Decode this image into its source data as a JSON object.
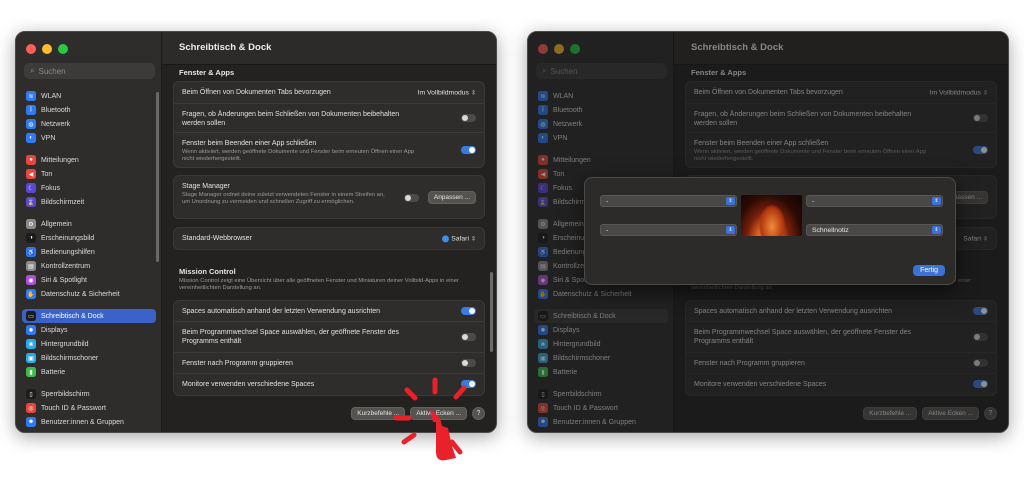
{
  "window": {
    "title": "Schreibtisch & Dock",
    "search_placeholder": "Suchen",
    "sidebar": [
      {
        "label": "WLAN",
        "icon": "wifi-icon",
        "color": "#2f7bf6",
        "glyph": "≋"
      },
      {
        "label": "Bluetooth",
        "icon": "bluetooth-icon",
        "color": "#2f7bf6",
        "glyph": "ᛒ"
      },
      {
        "label": "Netzwerk",
        "icon": "globe-icon",
        "color": "#2f7bf6",
        "glyph": "◍"
      },
      {
        "label": "VPN",
        "icon": "vpn-icon",
        "color": "#2f7bf6",
        "glyph": "◐"
      },
      {
        "label": "Mitteilungen",
        "icon": "bell-icon",
        "color": "#e5473d",
        "glyph": "●",
        "gap": true
      },
      {
        "label": "Ton",
        "icon": "speaker-icon",
        "color": "#e5473d",
        "glyph": "◀"
      },
      {
        "label": "Fokus",
        "icon": "moon-icon",
        "color": "#5a48d6",
        "glyph": "☾"
      },
      {
        "label": "Bildschirmzeit",
        "icon": "hourglass-icon",
        "color": "#5a48d6",
        "glyph": "⌛"
      },
      {
        "label": "Allgemein",
        "icon": "gear-icon",
        "color": "#8a8a8e",
        "glyph": "⚙",
        "gap": true
      },
      {
        "label": "Erscheinungsbild",
        "icon": "appearance-icon",
        "color": "#1c1c1c",
        "glyph": "◑"
      },
      {
        "label": "Bedienungshilfen",
        "icon": "accessibility-icon",
        "color": "#2f7bf6",
        "glyph": "♿"
      },
      {
        "label": "Kontrollzentrum",
        "icon": "control-center-icon",
        "color": "#8a8a8e",
        "glyph": "▤"
      },
      {
        "label": "Siri & Spotlight",
        "icon": "siri-icon",
        "color": "#b04ed8",
        "glyph": "◉"
      },
      {
        "label": "Datenschutz & Sicherheit",
        "icon": "hand-icon",
        "color": "#2f7bf6",
        "glyph": "✋"
      },
      {
        "label": "Schreibtisch & Dock",
        "icon": "dock-icon",
        "color": "#1c1c1c",
        "glyph": "▭",
        "selected": true,
        "gap": true
      },
      {
        "label": "Displays",
        "icon": "display-icon",
        "color": "#2f7bf6",
        "glyph": "✹"
      },
      {
        "label": "Hintergrundbild",
        "icon": "wallpaper-icon",
        "color": "#2fa8e6",
        "glyph": "❀"
      },
      {
        "label": "Bildschirmschoner",
        "icon": "screensaver-icon",
        "color": "#2fa8e6",
        "glyph": "▣"
      },
      {
        "label": "Batterie",
        "icon": "battery-icon",
        "color": "#3cbf4a",
        "glyph": "▮"
      },
      {
        "label": "Sperrbildschirm",
        "icon": "lock-screen-icon",
        "color": "#1c1c1c",
        "glyph": "▯",
        "gap": true
      },
      {
        "label": "Touch ID & Passwort",
        "icon": "fingerprint-icon",
        "color": "#e5473d",
        "glyph": "◎"
      },
      {
        "label": "Benutzer:innen & Gruppen",
        "icon": "users-icon",
        "color": "#2f7bf6",
        "glyph": "☻"
      }
    ],
    "content": {
      "section_fenster": "Fenster & Apps",
      "tabs_label": "Beim Öffnen von Dokumenten Tabs bevorzugen",
      "tabs_value": "Im Vollbildmodus",
      "ask_changes_label": "Fragen, ob Änderungen beim Schließen von Dokumenten beibehalten werden sollen",
      "close_windows_label": "Fenster beim Beenden einer App schließen",
      "close_windows_desc": "Wenn aktiviert, werden geöffnete Dokumente und Fenster beim erneuten Öffnen einer App nicht wiederhergestellt.",
      "stage_manager_label": "Stage Manager",
      "stage_manager_desc": "Stage Manager ordnet deine zuletzt verwendeten Fenster in einem Streifen an, um Unordnung zu vermeiden und schnellen Zugriff zu ermöglichen.",
      "stage_manager_button": "Anpassen ...",
      "browser_label": "Standard-Webbrowser",
      "browser_value": "Safari",
      "section_mission": "Mission Control",
      "mission_desc": "Mission Control zeigt eine Übersicht über alle geöffneten Fenster und Miniaturen deiner Vollbild-Apps in einer vereinheitlichten Darstellung an.",
      "spaces_rearrange_label": "Spaces automatisch anhand der letzten Verwendung ausrichten",
      "switch_space_label": "Beim Programmwechsel Space auswählen, der geöffnete Fenster des Programms enthält",
      "group_windows_label": "Fenster nach Programm gruppieren",
      "separate_spaces_label": "Monitore verwenden verschiedene Spaces",
      "shortcuts_button": "Kurzbefehle ...",
      "hot_corners_button": "Aktive Ecken ...",
      "help_button": "?"
    },
    "toggles": {
      "ask_changes": false,
      "close_windows": true,
      "stage_manager": false,
      "spaces_rearrange": true,
      "switch_space": false,
      "group_windows": false,
      "separate_spaces": true
    }
  },
  "hot_corners_sheet": {
    "top_left": "-",
    "top_right": "-",
    "bottom_left": "-",
    "bottom_right": "Schnellnotiz",
    "done_button": "Fertig",
    "hidden_browser_value": "Safari",
    "hidden_stage_button": "Anpassen ..."
  },
  "colors": {
    "accent": "#3a72d8",
    "highlight": "#e8212a"
  }
}
